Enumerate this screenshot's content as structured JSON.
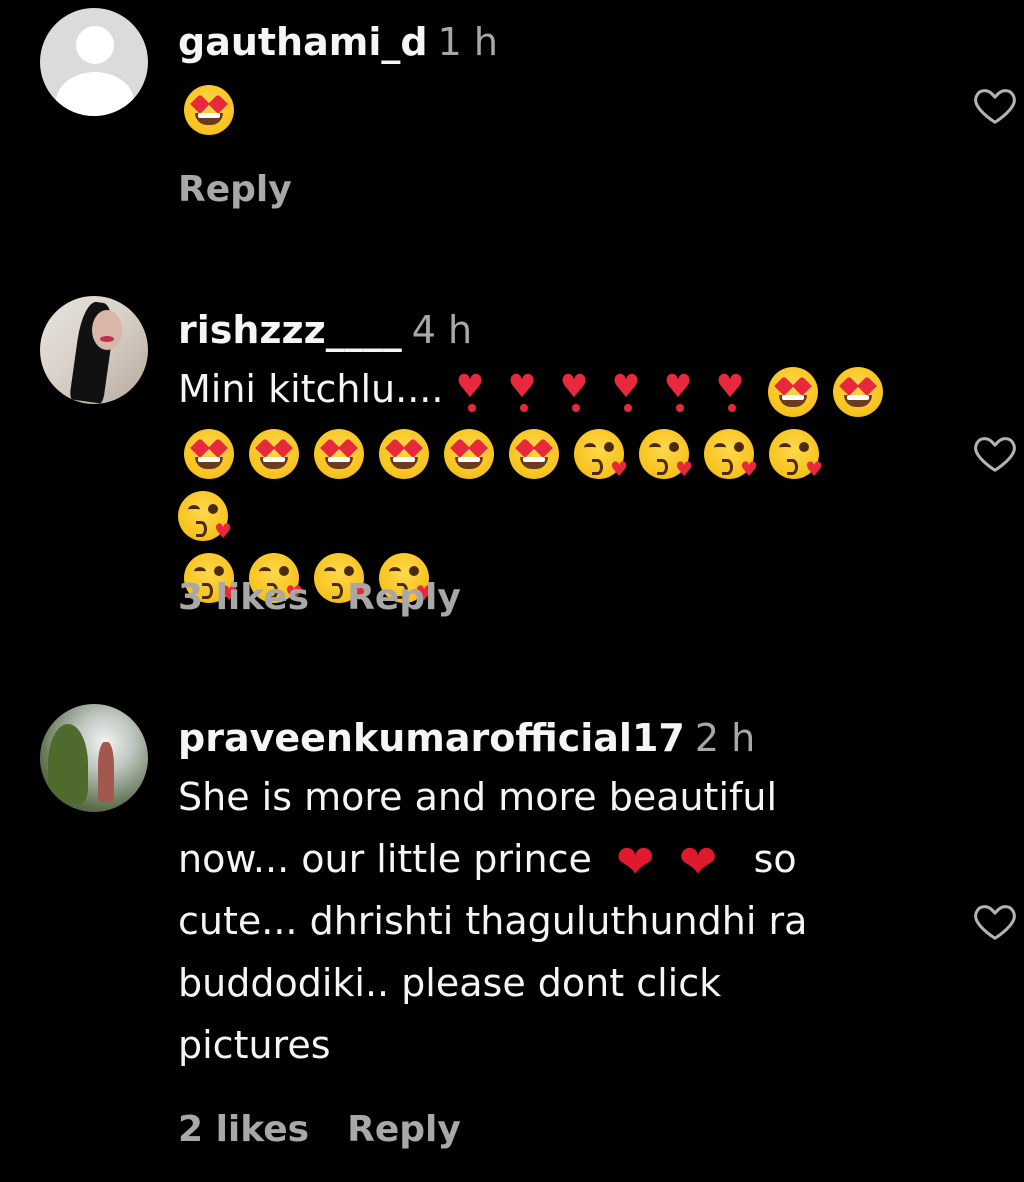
{
  "comments": [
    {
      "username": "gauthami_d",
      "time": "1 h",
      "likes": "",
      "reply": "Reply"
    },
    {
      "username": "rishzzz____",
      "time": "4 h",
      "text": "Mini kitchlu....",
      "likes": "3 likes",
      "reply": "Reply"
    },
    {
      "username": "praveenkumarofficial17",
      "time": "2 h",
      "text_lines": [
        "She is more and more beautiful",
        "now... our little prince",
        "so",
        "cute... dhrishti thaguluthundhi ra",
        "buddodiki.. please dont click",
        "pictures"
      ],
      "likes": "2 likes",
      "reply": "Reply"
    }
  ],
  "icons": {
    "like": "heart-outline-icon",
    "emoji_love": "smiling-face-with-heart-eyes",
    "emoji_kiss": "face-blowing-a-kiss",
    "emoji_exclamation_heart": "heart-exclamation",
    "emoji_red_heart": "red-heart"
  },
  "colors": {
    "background": "#000000",
    "text": "#f5f5f5",
    "secondary": "#a8a8a8",
    "heart_red": "#e0192d"
  }
}
